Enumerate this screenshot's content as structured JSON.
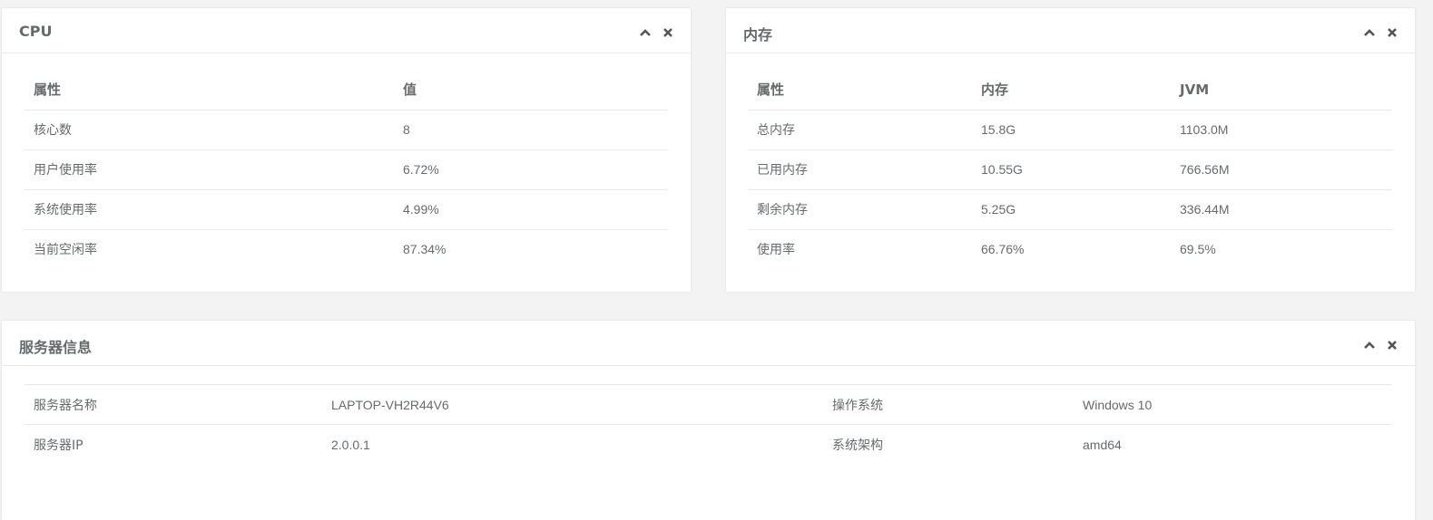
{
  "cpu": {
    "title": "CPU",
    "headers": [
      "属性",
      "值"
    ],
    "rows": [
      [
        "核心数",
        "8"
      ],
      [
        "用户使用率",
        "6.72%"
      ],
      [
        "系统使用率",
        "4.99%"
      ],
      [
        "当前空闲率",
        "87.34%"
      ]
    ]
  },
  "memory": {
    "title": "内存",
    "headers": [
      "属性",
      "内存",
      "JVM"
    ],
    "rows": [
      [
        "总内存",
        "15.8G",
        "1103.0M"
      ],
      [
        "已用内存",
        "10.55G",
        "766.56M"
      ],
      [
        "剩余内存",
        "5.25G",
        "336.44M"
      ],
      [
        "使用率",
        "66.76%",
        "69.5%"
      ]
    ]
  },
  "server": {
    "title": "服务器信息",
    "rows": [
      [
        "服务器名称",
        "LAPTOP-VH2R44V6",
        "操作系统",
        "Windows 10"
      ],
      [
        "服务器IP",
        "2.0.0.1",
        "系统架构",
        "amd64"
      ]
    ]
  },
  "icons": {
    "collapse": "chevron-up-icon",
    "close": "close-icon"
  },
  "colors": {
    "background": "#f3f3f4",
    "panel": "#ffffff",
    "text": "#676a6c",
    "border": "#e7eaec"
  }
}
